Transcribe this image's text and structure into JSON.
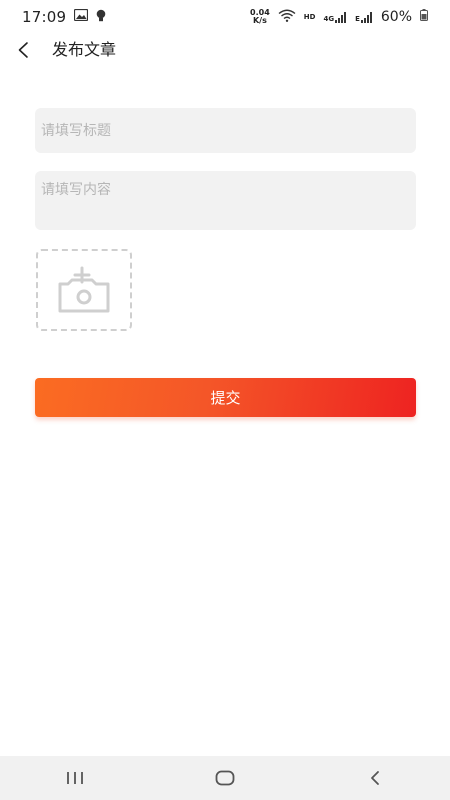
{
  "status_bar": {
    "time": "17:09",
    "net_speed_value": "0.04",
    "net_speed_unit": "K/s",
    "hd_label": "HD",
    "network_4g": "4G",
    "network_e": "E",
    "battery_percent": "60%"
  },
  "header": {
    "title": "发布文章"
  },
  "form": {
    "title_placeholder": "请填写标题",
    "content_placeholder": "请填写内容",
    "submit_label": "提交"
  },
  "icons": {
    "back": "chevron-left-icon",
    "image_add": "camera-plus-icon",
    "nav_recent": "recent-apps-icon",
    "nav_home": "home-icon",
    "nav_back": "back-icon"
  },
  "colors": {
    "accent_start": "#fb6c22",
    "accent_end": "#ee2321",
    "input_bg": "#f2f2f2",
    "placeholder": "#b6b6b6"
  }
}
